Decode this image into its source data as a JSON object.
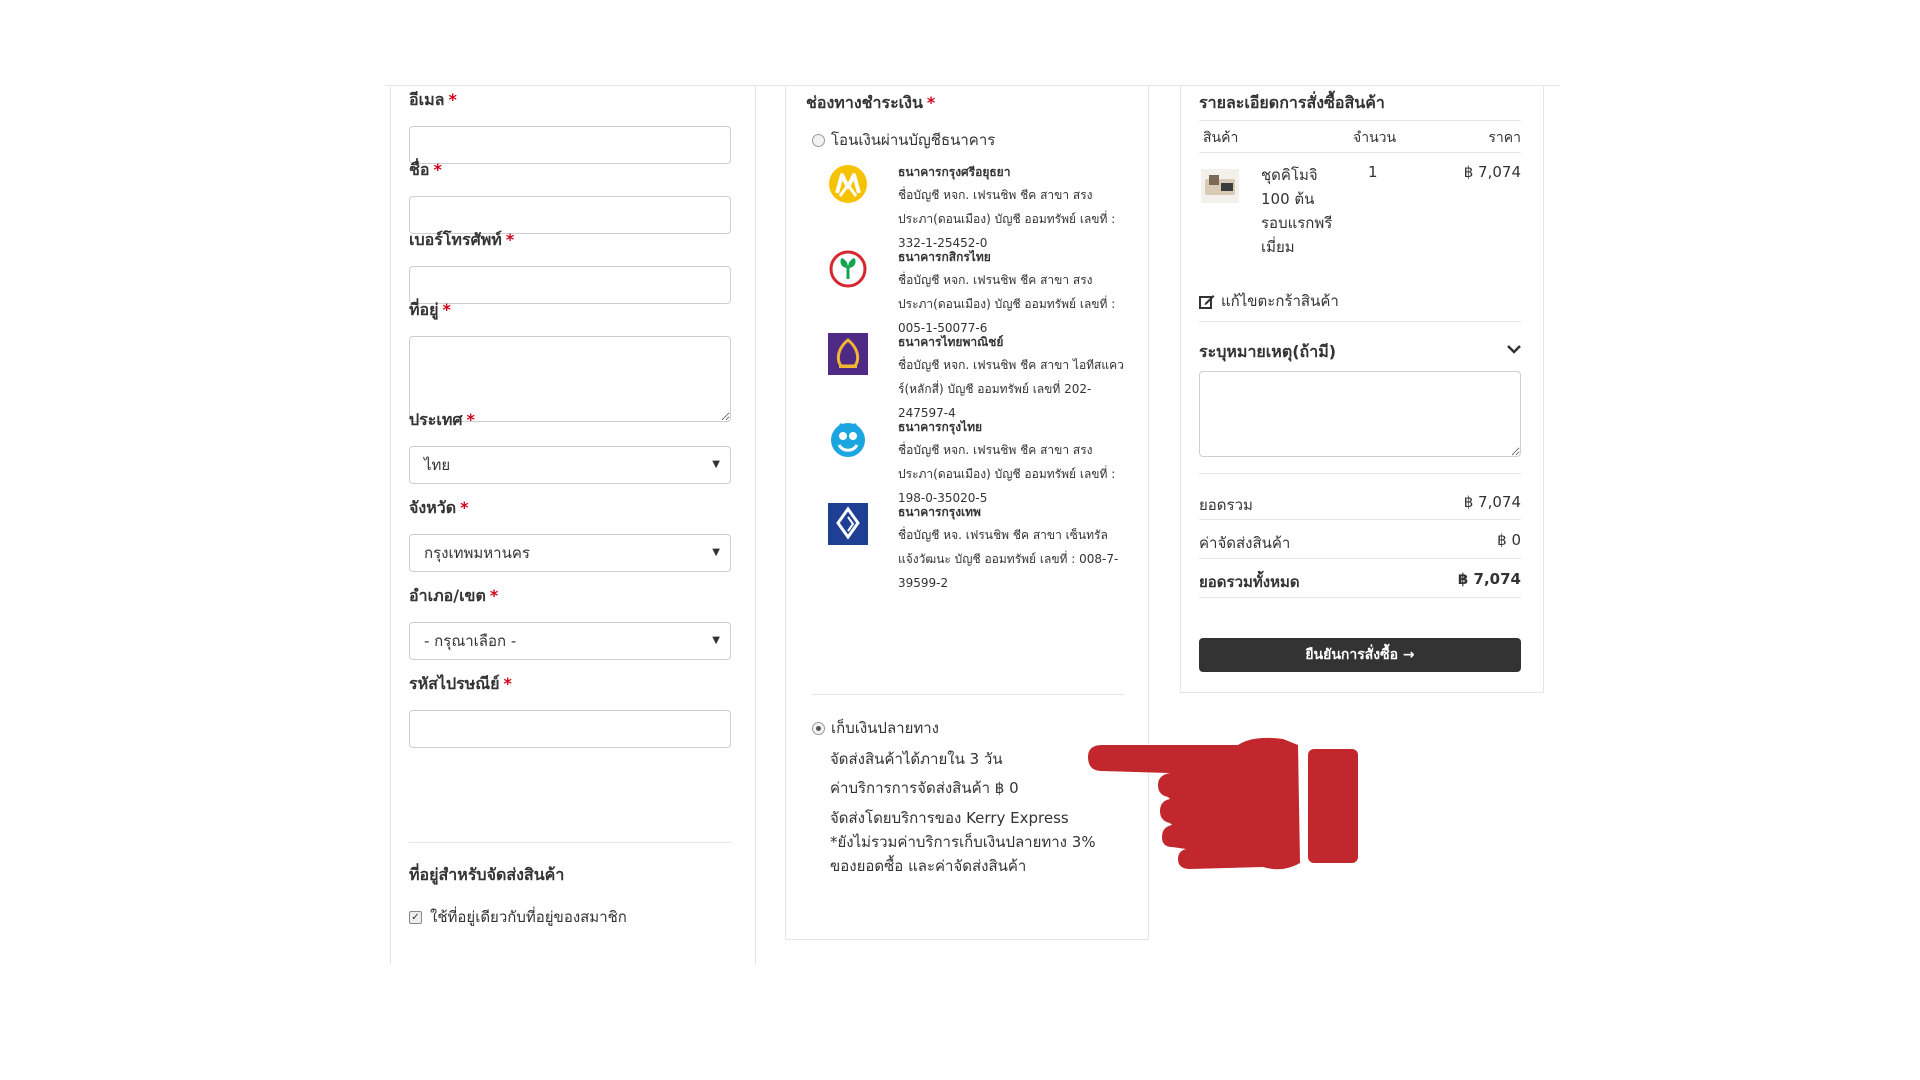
{
  "form": {
    "email": {
      "label": "อีเมล",
      "required": "*",
      "value": ""
    },
    "name": {
      "label": "ชื่อ",
      "required": "*",
      "value": ""
    },
    "phone": {
      "label": "เบอร์โทรศัพท์",
      "required": "*",
      "value": ""
    },
    "address": {
      "label": "ที่อยู่",
      "required": "*",
      "value": ""
    },
    "country": {
      "label": "ประเทศ",
      "required": "*",
      "value": "ไทย"
    },
    "province": {
      "label": "จังหวัด",
      "required": "*",
      "value": "กรุงเทพมหานคร"
    },
    "district": {
      "label": "อำเภอ/เขต",
      "required": "*",
      "value": "- กรุณาเลือก -"
    },
    "postcode": {
      "label": "รหัสไปรษณีย์",
      "required": "*",
      "value": ""
    },
    "shipping_title": "ที่อยู่สำหรับจัดส่งสินค้า",
    "same_address_label": "ใช้ที่อยู่เดียวกับที่อยู่ของสมาชิก",
    "same_address_checked": true
  },
  "payment": {
    "title": "ช่องทางชำระเงิน",
    "required": "*",
    "bank_transfer_label": "โอนเงินผ่านบัญชีธนาคาร",
    "banks": [
      {
        "name": "ธนาคารกรุงศรีอยุธยา",
        "detail": "ชื่อบัญชี หจก. เฟรนชิพ ชีค สาขา สรงประภา(ดอนเมือง) บัญชี ออมทรัพย์ เลขที่ : 332-1-25452-0",
        "color": "#f7c200",
        "icon": "krungsri-logo"
      },
      {
        "name": "ธนาคารกสิกรไทย",
        "detail": "ชื่อบัญชี หจก. เฟรนชิพ ชีค สาขา สรงประภา(ดอนเมือง) บัญชี ออมทรัพย์ เลขที่ : 005-1-50077-6",
        "color": "#12a650",
        "icon": "kasikorn-logo"
      },
      {
        "name": "ธนาคารไทยพาณิชย์",
        "detail": "ชื่อบัญชี หจก. เฟรนชิพ ชีค สาขา ไอทีสแควร์(หลักสี่) บัญชี ออมทรัพย์ เลขที่ 202-247597-4",
        "color": "#4e2a84",
        "icon": "scb-logo"
      },
      {
        "name": "ธนาคารกรุงไทย",
        "detail": "ชื่อบัญชี หจก. เฟรนชิพ ชีค สาขา สรงประภา(ดอนเมือง) บัญชี ออมทรัพย์ เลขที่ : 198-0-35020-5",
        "color": "#1ba5e1",
        "icon": "ktb-logo"
      },
      {
        "name": "ธนาคารกรุงเทพ",
        "detail": "ชื่อบัญชี หจ. เฟรนชิพ ชีค สาขา เซ็นทรัลแจ้งวัฒนะ บัญชี ออมทรัพย์ เลขที่ : 008-7-39599-2",
        "color": "#1e3f94",
        "icon": "bbl-logo"
      }
    ],
    "cod_label": "เก็บเงินปลายทาง",
    "cod_delivery": "จัดส่งสินค้าได้ภายใน 3  วัน",
    "cod_fee": "ค่าบริการการจัดส่งสินค้า ฿ 0",
    "cod_carrier": "จัดส่งโดยบริการของ Kerry Express",
    "cod_note": "*ยังไม่รวมค่าบริการเก็บเงินปลายทาง 3% ของยอดซื้อ และค่าจัดส่งสินค้า"
  },
  "order": {
    "title": "รายละเอียดการสั่งซื้อสินค้า",
    "col_product": "สินค้า",
    "col_qty": "จำนวน",
    "col_price": "ราคา",
    "item": {
      "name": "ชุดคิโมจิ 100 ต้น รอบแรกพรีเมี่ยม",
      "qty": "1",
      "price": "฿ 7,074"
    },
    "edit_cart": "แก้ไขตะกร้าสินค้า",
    "note_title": "ระบุหมายเหตุ(ถ้ามี)",
    "subtotal_label": "ยอดรวม",
    "subtotal_value": "฿ 7,074",
    "shipping_label": "ค่าจัดส่งสินค้า",
    "shipping_value": "฿ 0",
    "total_label": "ยอดรวมทั้งหมด",
    "total_value": "฿ 7,074",
    "confirm_label": "ยืนยันการสั่งซื้อ",
    "confirm_arrow": "→"
  },
  "colors": {
    "required": "#d0021b",
    "button": "#333333",
    "hand": "#c1272d"
  }
}
